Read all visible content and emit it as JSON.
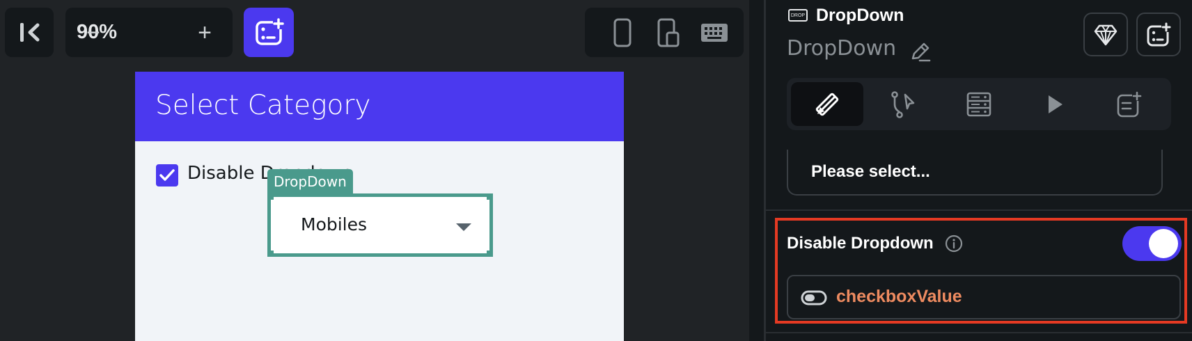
{
  "toolbar": {
    "zoom_minus": "−",
    "zoom_value": "90%",
    "zoom_plus": "+"
  },
  "canvas": {
    "app_title": "Select Category",
    "checkbox_label": "Disable Dropdown",
    "checkbox_checked": true,
    "selected_widget_tag": "DropDown",
    "dropdown_value": "Mobiles"
  },
  "panel": {
    "widget_type_badge": "DROP",
    "widget_type_label": "DropDown",
    "widget_name": "DropDown",
    "tabs": [
      {
        "name": "properties",
        "active": true
      },
      {
        "name": "actions",
        "active": false
      },
      {
        "name": "backend-query",
        "active": false
      },
      {
        "name": "animations",
        "active": false
      },
      {
        "name": "add-widget-state",
        "active": false
      }
    ],
    "hint_text": "Please select...",
    "disable_label": "Disable Dropdown",
    "disable_enabled": true,
    "bound_variable": "checkboxValue"
  },
  "colors": {
    "primary": "#4b39ef",
    "widget_outline": "#4a9a8c",
    "variable_text": "#ee8b60",
    "highlight": "#e53a23"
  }
}
